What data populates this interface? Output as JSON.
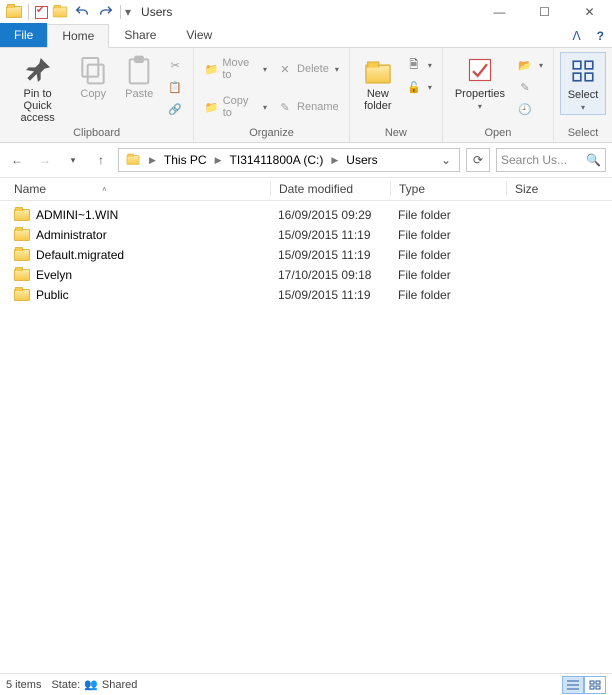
{
  "title": "Users",
  "tabs": {
    "file": "File",
    "home": "Home",
    "share": "Share",
    "view": "View"
  },
  "ribbon": {
    "clipboard": {
      "label": "Clipboard",
      "pin": "Pin to Quick\naccess",
      "copy": "Copy",
      "paste": "Paste"
    },
    "organize": {
      "label": "Organize",
      "moveto": "Move to",
      "copyto": "Copy to",
      "delete": "Delete",
      "rename": "Rename"
    },
    "new": {
      "label": "New",
      "newfolder": "New\nfolder"
    },
    "open": {
      "label": "Open",
      "properties": "Properties"
    },
    "select": {
      "label": "Select",
      "select": "Select"
    }
  },
  "breadcrumbs": [
    "This PC",
    "TI31411800A (C:)",
    "Users"
  ],
  "search_placeholder": "Search Us...",
  "columns": {
    "name": "Name",
    "date": "Date modified",
    "type": "Type",
    "size": "Size"
  },
  "items": [
    {
      "name": "ADMINI~1.WIN",
      "date": "16/09/2015 09:29",
      "type": "File folder",
      "size": ""
    },
    {
      "name": "Administrator",
      "date": "15/09/2015 11:19",
      "type": "File folder",
      "size": ""
    },
    {
      "name": "Default.migrated",
      "date": "15/09/2015 11:19",
      "type": "File folder",
      "size": ""
    },
    {
      "name": "Evelyn",
      "date": "17/10/2015 09:18",
      "type": "File folder",
      "size": ""
    },
    {
      "name": "Public",
      "date": "15/09/2015 11:19",
      "type": "File folder",
      "size": ""
    }
  ],
  "status": {
    "count": "5 items",
    "state_label": "State:",
    "state_value": "Shared"
  }
}
